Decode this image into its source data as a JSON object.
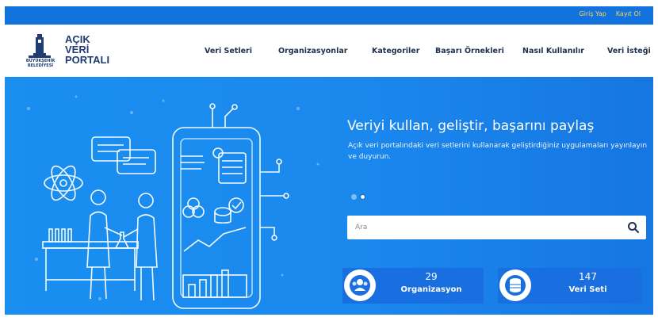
{
  "topbar": {
    "login_label": "Giriş Yap",
    "register_label": "Kayıt Ol",
    "link_color": "#ffd34d",
    "background": "#1273df"
  },
  "logo": {
    "line1": "AÇIK",
    "line2": "VERİ",
    "line3": "PORTALI",
    "subtitle_line1": "BÜYÜKŞEHİR",
    "subtitle_line2": "BELEDİYESİ",
    "brand_color": "#1f3c73"
  },
  "menu": {
    "items": [
      {
        "label": "Veri Setleri"
      },
      {
        "label": "Organizasyonlar"
      },
      {
        "label": "Kategoriler"
      },
      {
        "label": "Başarı Örnekleri"
      },
      {
        "label": "Nasıl Kullanılır"
      },
      {
        "label": "Veri İsteği"
      }
    ]
  },
  "hero": {
    "title": "Veriyi kullan, geliştir, başarını paylaş",
    "description": "Açık veri portalındaki veri setlerini kullanarak geliştirdiğiniz uygulamaları yayınlayın ve duyurun.",
    "carousel_active": 2,
    "carousel_count": 2,
    "accent_color": "#1a8ff0"
  },
  "search": {
    "placeholder": "Ara",
    "value": "",
    "icon": "search-icon"
  },
  "stats": [
    {
      "number": "29",
      "label": "Organizasyon",
      "icon": "organization-icon"
    },
    {
      "number": "147",
      "label": "Veri Seti",
      "icon": "dataset-icon"
    }
  ]
}
